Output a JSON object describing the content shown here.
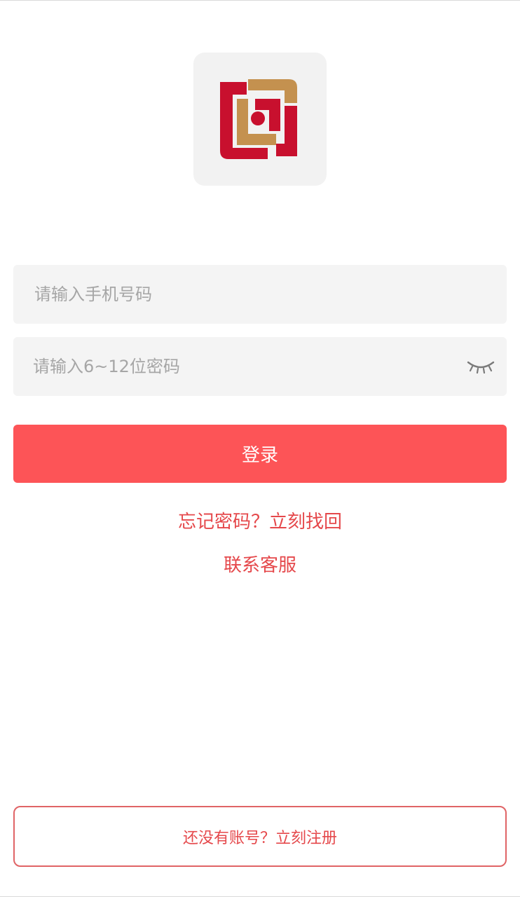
{
  "colors": {
    "accent": "#fd5457",
    "link": "#e5484b",
    "field_bg": "#f4f4f4",
    "logo_red": "#c8102e",
    "logo_gold": "#c4914f"
  },
  "logo": {
    "icon": "brand-logo-icon"
  },
  "form": {
    "phone": {
      "placeholder": "请输入手机号码",
      "value": ""
    },
    "password": {
      "placeholder": "请输入6~12位密码",
      "value": "",
      "toggle_icon": "eye-closed-icon"
    },
    "login_label": "登录"
  },
  "links": {
    "forgot_password": "忘记密码？立刻找回",
    "contact_service": "联系客服"
  },
  "footer": {
    "register_label": "还没有账号？立刻注册"
  }
}
